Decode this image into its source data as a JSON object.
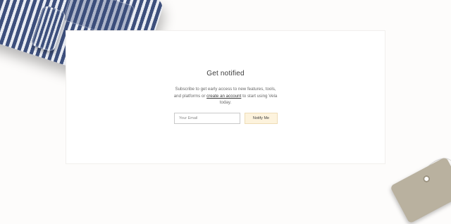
{
  "signup": {
    "title": "Get notified",
    "description_pre": "Subscribe to get early access to new features, tools, and platforms or ",
    "link_text": "create an account",
    "description_post": " to start using Vela today.",
    "email_placeholder": "Your Email",
    "email_value": "",
    "button_label": "Notify Me"
  },
  "colors": {
    "button_bg": "#fdf3dd",
    "button_border": "#eedcb6",
    "stripe_navy": "#3d4f7c"
  }
}
